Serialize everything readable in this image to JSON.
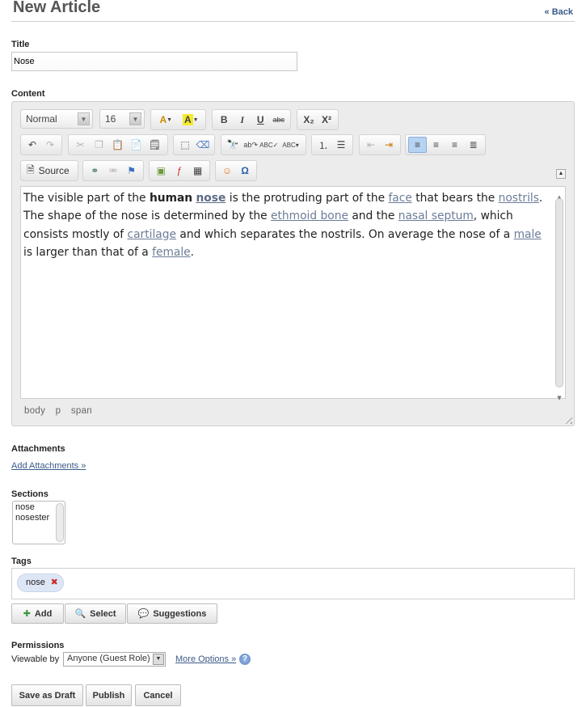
{
  "header": {
    "title": "New Article",
    "back_label": "« Back"
  },
  "title_field": {
    "label": "Title",
    "value": "Nose"
  },
  "content_field": {
    "label": "Content"
  },
  "editor": {
    "format_value": "Normal",
    "size_value": "16",
    "source_label": "Source",
    "path": [
      "body",
      "p",
      "span"
    ],
    "body": {
      "t1": "The visible part of the ",
      "b1": "human",
      "l_nose": "nose",
      "t2": " is the protruding part of the ",
      "l_face": "face",
      "t3": " that bears the ",
      "l_nostrils": "nostrils",
      "t4": ". The shape of the nose is determined by the ",
      "l_ethmoid": "ethmoid bone",
      "t5": " and the ",
      "l_septum": "nasal septum",
      "t6": ", which consists mostly of ",
      "l_cartilage": "cartilage",
      "t7": " and which separates the nostrils. On average the nose of a ",
      "l_male": "male",
      "t8": " is larger than that of a ",
      "l_female": "female",
      "t9": "."
    },
    "icons": {
      "font_color": "font-color-icon",
      "bg_color": "background-color-icon",
      "bold": "B",
      "italic": "I",
      "underline": "U",
      "strike": "abc",
      "subscript": "X₂",
      "superscript": "X²"
    }
  },
  "attachments": {
    "label": "Attachments",
    "add_link": "Add Attachments »"
  },
  "sections": {
    "label": "Sections",
    "items": [
      "nose",
      "nosester"
    ]
  },
  "tags": {
    "label": "Tags",
    "items": [
      "nose"
    ],
    "add_label": "Add",
    "select_label": "Select",
    "suggestions_label": "Suggestions"
  },
  "permissions": {
    "label": "Permissions",
    "viewable_label": "Viewable by",
    "viewable_value": "Anyone (Guest Role)",
    "more_options": "More Options »"
  },
  "actions": {
    "draft": "Save as Draft",
    "publish": "Publish",
    "cancel": "Cancel"
  }
}
